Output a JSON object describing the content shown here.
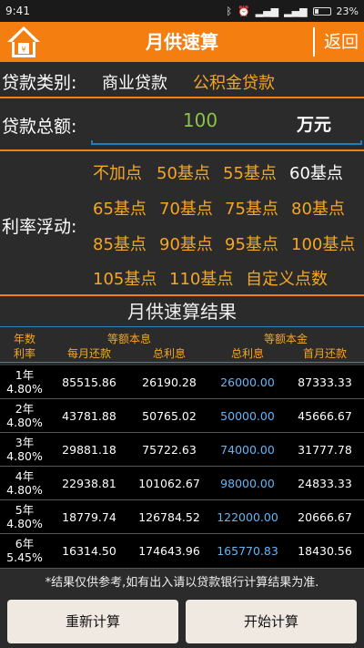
{
  "status": {
    "time": "9:41",
    "battery": "23%"
  },
  "header": {
    "title": "月供速算",
    "back_label": "返回"
  },
  "loan_type": {
    "label": "贷款类别:",
    "options": [
      "商业贷款",
      "公积金贷款"
    ],
    "selected": "商业贷款"
  },
  "loan_amount": {
    "label": "贷款总额:",
    "value": "100",
    "unit": "万元"
  },
  "rate_float": {
    "label": "利率浮动:",
    "options": [
      "不加点",
      "50基点",
      "55基点",
      "60基点",
      "65基点",
      "70基点",
      "75基点",
      "80基点",
      "85基点",
      "90基点",
      "95基点",
      "100基点",
      "105基点",
      "110基点",
      "自定义点数"
    ],
    "selected": "60基点"
  },
  "results": {
    "title": "月供速算结果",
    "headers": {
      "term": "年数",
      "rate": "利率",
      "equal_interest": "等额本息",
      "monthly": "每月还款",
      "total_interest_1": "总利息",
      "equal_principal": "等额本金",
      "total_interest_2": "总利息",
      "first_month": "首月还款"
    },
    "rows": [
      {
        "term": "1年",
        "rate": "4.80%",
        "monthly": "85515.86",
        "interest1": "26190.28",
        "interest2": "26000.00",
        "first": "87333.33"
      },
      {
        "term": "2年",
        "rate": "4.80%",
        "monthly": "43781.88",
        "interest1": "50765.02",
        "interest2": "50000.00",
        "first": "45666.67"
      },
      {
        "term": "3年",
        "rate": "4.80%",
        "monthly": "29881.18",
        "interest1": "75722.63",
        "interest2": "74000.00",
        "first": "31777.78"
      },
      {
        "term": "4年",
        "rate": "4.80%",
        "monthly": "22938.81",
        "interest1": "101062.67",
        "interest2": "98000.00",
        "first": "24833.33"
      },
      {
        "term": "5年",
        "rate": "4.80%",
        "monthly": "18779.74",
        "interest1": "126784.52",
        "interest2": "122000.00",
        "first": "20666.67"
      },
      {
        "term": "6年",
        "rate": "5.45%",
        "monthly": "16314.50",
        "interest1": "174643.96",
        "interest2": "165770.83",
        "first": "18430.56"
      }
    ]
  },
  "note": "*结果仅供参考,如有出入请以贷款银行计算结果为准.",
  "buttons": {
    "reset": "重新计算",
    "start": "开始计算"
  },
  "colors": {
    "accent": "#f47f10",
    "option": "#f5a623",
    "amount": "#8bc34a",
    "interest_blue": "#64b5f6"
  }
}
